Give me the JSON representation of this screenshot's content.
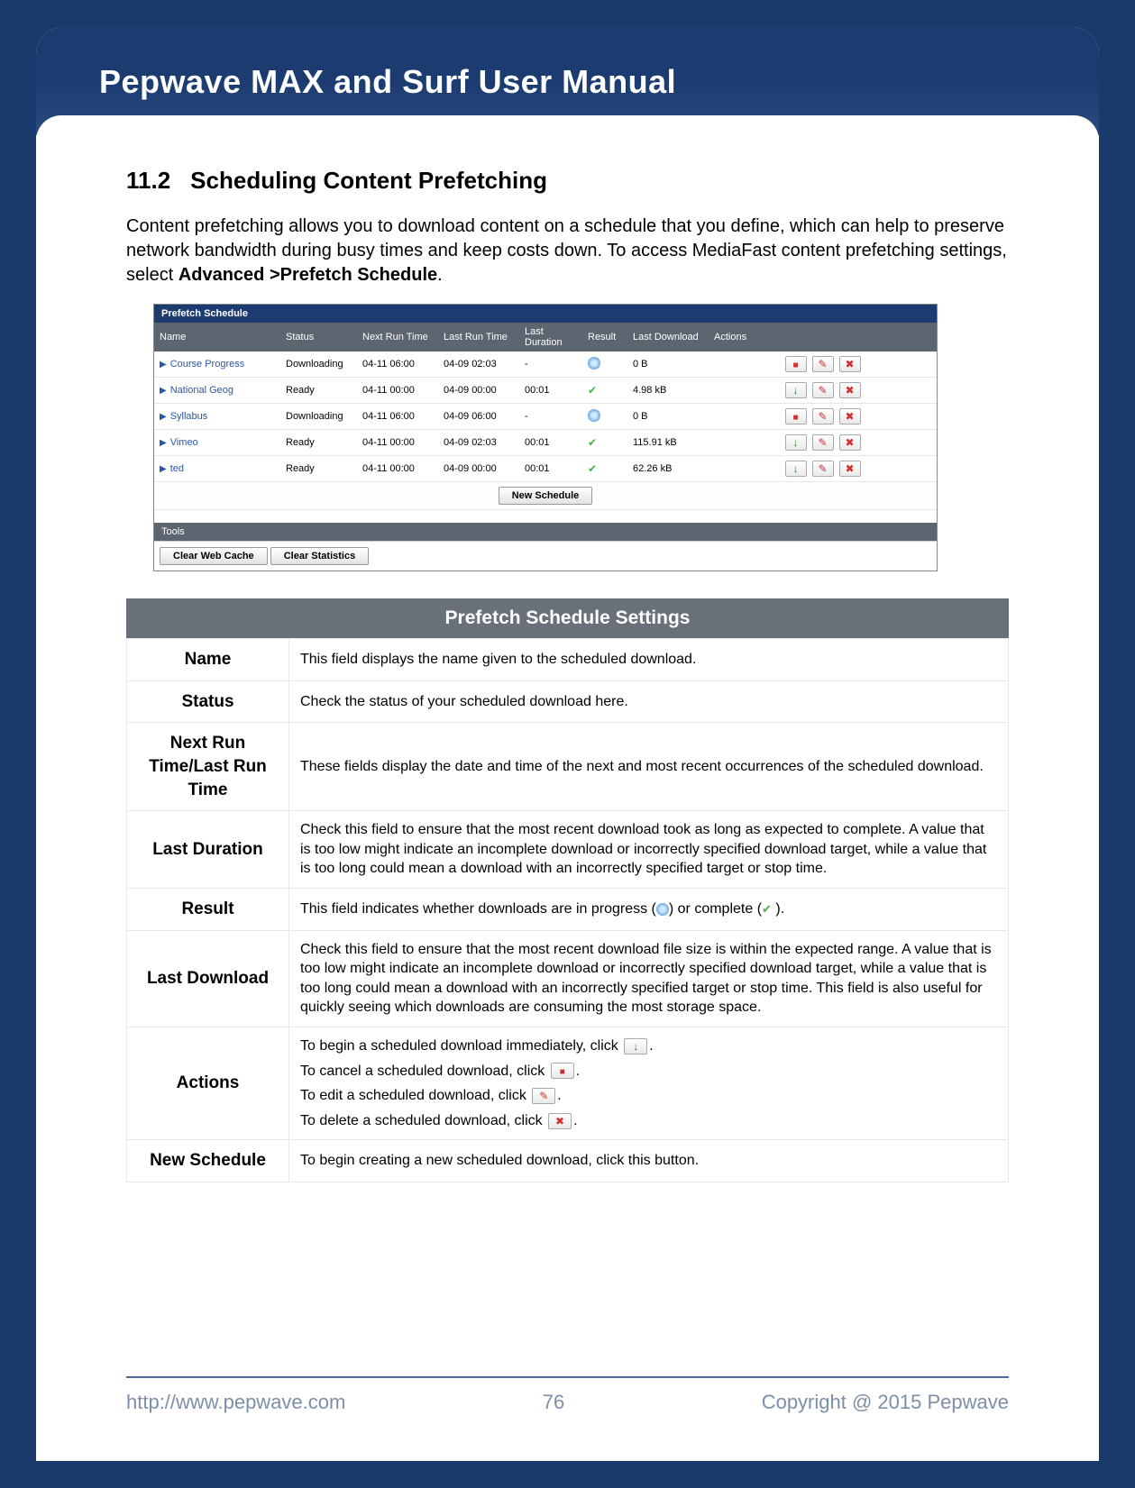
{
  "doc_title": "Pepwave MAX and Surf User Manual",
  "section": {
    "number": "11.2",
    "title": "Scheduling Content Prefetching"
  },
  "intro": {
    "p1_a": "Content prefetching allows you to download content on a schedule that you define, which can help to preserve network bandwidth during busy times and keep costs down. To access MediaFast content prefetching settings, select ",
    "p1_b": "Advanced >Prefetch Schedule",
    "p1_c": "."
  },
  "screenshot": {
    "panel_title": "Prefetch Schedule",
    "headers": [
      "Name",
      "Status",
      "Next Run Time",
      "Last Run Time",
      "Last Duration",
      "Result",
      "Last Download",
      "Actions"
    ],
    "rows": [
      {
        "name": "Course Progress",
        "status": "Downloading",
        "next": "04-11 06:00",
        "last": "04-09 02:03",
        "dur": "-",
        "result": "progress",
        "dl": "0 B",
        "first_action": "stop"
      },
      {
        "name": "National Geog",
        "status": "Ready",
        "next": "04-11 00:00",
        "last": "04-09 00:00",
        "dur": "00:01",
        "result": "ok",
        "dl": "4.98 kB",
        "first_action": "start"
      },
      {
        "name": "Syllabus",
        "status": "Downloading",
        "next": "04-11 06:00",
        "last": "04-09 06:00",
        "dur": "-",
        "result": "progress",
        "dl": "0 B",
        "first_action": "stop"
      },
      {
        "name": "Vimeo",
        "status": "Ready",
        "next": "04-11 00:00",
        "last": "04-09 02:03",
        "dur": "00:01",
        "result": "ok",
        "dl": "115.91 kB",
        "first_action": "start"
      },
      {
        "name": "ted",
        "status": "Ready",
        "next": "04-11 00:00",
        "last": "04-09 00:00",
        "dur": "00:01",
        "result": "ok",
        "dl": "62.26 kB",
        "first_action": "start"
      }
    ],
    "new_schedule_label": "New Schedule",
    "tools_title": "Tools",
    "tools_buttons": [
      "Clear Web Cache",
      "Clear Statistics"
    ]
  },
  "settings": {
    "heading": "Prefetch Schedule Settings",
    "rows": [
      {
        "label": "Name",
        "desc": "This field displays the name given to the scheduled download."
      },
      {
        "label": "Status",
        "desc": "Check the status of your scheduled download here."
      },
      {
        "label": "Next Run Time/Last Run Time",
        "desc": "These fields display the date and time of the next and most recent occurrences of the scheduled download."
      },
      {
        "label": "Last Duration",
        "desc": "Check this field to ensure that the most recent download took as long as expected to complete. A value that is too low might indicate an incomplete download or incorrectly specified download target, while a value that is too long could mean a download with an incorrectly specified target or stop time."
      },
      {
        "label": "Result",
        "desc_a": "This field indicates whether downloads are in progress (",
        "desc_b": ") or complete (",
        "desc_c": " )."
      },
      {
        "label": "Last Download",
        "desc": "Check this field to ensure that the most recent download file size is within the expected range. A value that is too low might indicate an incomplete download or incorrectly specified download target, while a value that is too long could mean a download with an incorrectly specified target or stop time. This field is also useful for quickly seeing which downloads are consuming the most storage space."
      },
      {
        "label": "Actions",
        "a1": "To begin a scheduled download immediately, click ",
        "a2": "To cancel a scheduled download, click ",
        "a3": "To edit a scheduled download, click ",
        "a4": "To delete a scheduled download, click ",
        "dot": "."
      },
      {
        "label": "New Schedule",
        "desc": "To begin creating a new scheduled download, click this button."
      }
    ]
  },
  "footer": {
    "url": "http://www.pepwave.com",
    "page": "76",
    "copyright": "Copyright @ 2015 Pepwave"
  }
}
